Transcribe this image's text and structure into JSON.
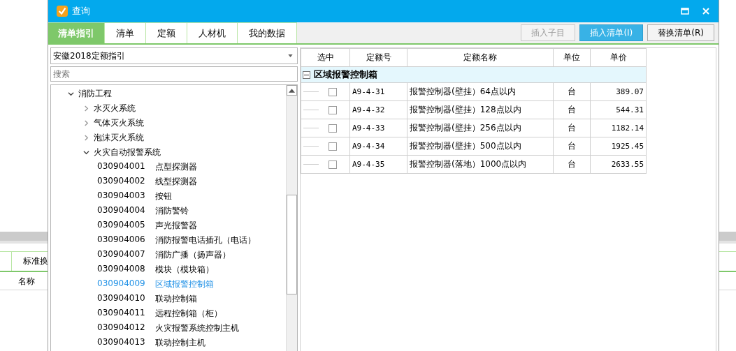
{
  "background_app": {
    "columns": [
      "标准换",
      "名称"
    ]
  },
  "window": {
    "title": "查询"
  },
  "tabs": [
    {
      "label": "清单指引",
      "selected": true
    },
    {
      "label": "清单",
      "selected": false
    },
    {
      "label": "定额",
      "selected": false
    },
    {
      "label": "人材机",
      "selected": false
    },
    {
      "label": "我的数据",
      "selected": false
    }
  ],
  "buttons": [
    {
      "label": "插入子目",
      "kind": "normal",
      "disabled": true
    },
    {
      "label": "插入清单(I)",
      "kind": "default",
      "disabled": false
    },
    {
      "label": "替换清单(R)",
      "kind": "normal",
      "disabled": false
    }
  ],
  "library_select": {
    "value": "安徽2018定额指引"
  },
  "search": {
    "placeholder": "搜索"
  },
  "tree": [
    {
      "label": "消防工程",
      "expanded": true,
      "children": [
        {
          "label": "水灭火系统",
          "expanded": false
        },
        {
          "label": "气体灭火系统",
          "expanded": false
        },
        {
          "label": "泡沫灭火系统",
          "expanded": false
        },
        {
          "label": "火灾自动报警系统",
          "expanded": true,
          "children": [
            {
              "code": "030904001",
              "label": "点型探测器",
              "selected": false
            },
            {
              "code": "030904002",
              "label": "线型探测器",
              "selected": false
            },
            {
              "code": "030904003",
              "label": "按钮",
              "selected": false
            },
            {
              "code": "030904004",
              "label": "消防警铃",
              "selected": false
            },
            {
              "code": "030904005",
              "label": "声光报警器",
              "selected": false
            },
            {
              "code": "030904006",
              "label": "消防报警电话插孔（电话）",
              "selected": false
            },
            {
              "code": "030904007",
              "label": "消防广播（扬声器）",
              "selected": false
            },
            {
              "code": "030904008",
              "label": "模块（模块箱）",
              "selected": false
            },
            {
              "code": "030904009",
              "label": "区域报警控制箱",
              "selected": true
            },
            {
              "code": "030904010",
              "label": "联动控制箱",
              "selected": false
            },
            {
              "code": "030904011",
              "label": "远程控制箱（柜）",
              "selected": false
            },
            {
              "code": "030904012",
              "label": "火灾报警系统控制主机",
              "selected": false
            },
            {
              "code": "030904013",
              "label": "联动控制主机",
              "selected": false
            }
          ]
        }
      ]
    }
  ],
  "table": {
    "columns": [
      "选中",
      "定额号",
      "定额名称",
      "单位",
      "单价"
    ],
    "group": {
      "title": "区域报警控制箱",
      "expanded": true
    },
    "rows": [
      {
        "checked": false,
        "code": "A9-4-31",
        "name": "报警控制器(壁挂）64点以内",
        "unit": "台",
        "price": "389.07"
      },
      {
        "checked": false,
        "code": "A9-4-32",
        "name": "报警控制器(壁挂）128点以内",
        "unit": "台",
        "price": "544.31"
      },
      {
        "checked": false,
        "code": "A9-4-33",
        "name": "报警控制器(壁挂）256点以内",
        "unit": "台",
        "price": "1182.14"
      },
      {
        "checked": false,
        "code": "A9-4-34",
        "name": "报警控制器(壁挂）500点以内",
        "unit": "台",
        "price": "1925.45"
      },
      {
        "checked": false,
        "code": "A9-4-35",
        "name": "报警控制器(落地）1000点以内",
        "unit": "台",
        "price": "2633.55"
      }
    ]
  }
}
